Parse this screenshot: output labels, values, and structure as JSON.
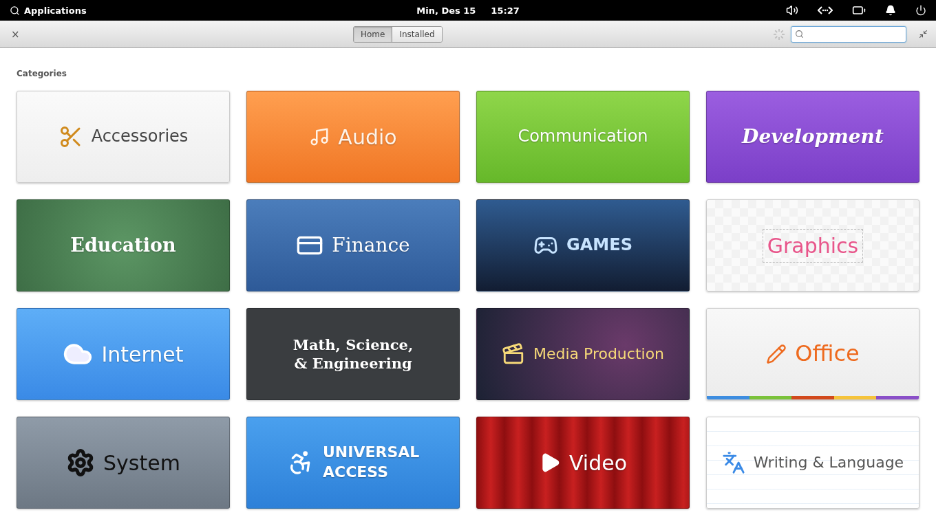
{
  "panel": {
    "launcher": "Applications",
    "date": "Min, Des 15",
    "time": "15:27"
  },
  "header": {
    "close": "×",
    "tabs": [
      {
        "label": "Home",
        "selected": true
      },
      {
        "label": "Installed",
        "selected": false
      }
    ]
  },
  "section_title": "Categories",
  "categories": [
    {
      "label": "Accessories",
      "kind": "accessories"
    },
    {
      "label": "Audio",
      "kind": "audio"
    },
    {
      "label": "Communication",
      "kind": "communication"
    },
    {
      "label": "Development",
      "kind": "development"
    },
    {
      "label": "Education",
      "kind": "education"
    },
    {
      "label": "Finance",
      "kind": "finance"
    },
    {
      "label": "GAMES",
      "kind": "games"
    },
    {
      "label": "Graphics",
      "kind": "graphics"
    },
    {
      "label": "Internet",
      "kind": "internet"
    },
    {
      "label": "Math, Science, & Engineering",
      "kind": "science"
    },
    {
      "label": "Media Production",
      "kind": "media"
    },
    {
      "label": "Office",
      "kind": "office"
    },
    {
      "label": "System",
      "kind": "system"
    },
    {
      "label": "UNIVERSAL ACCESS",
      "kind": "access"
    },
    {
      "label": "Video",
      "kind": "video"
    },
    {
      "label": "Writing & Language",
      "kind": "writing"
    }
  ]
}
